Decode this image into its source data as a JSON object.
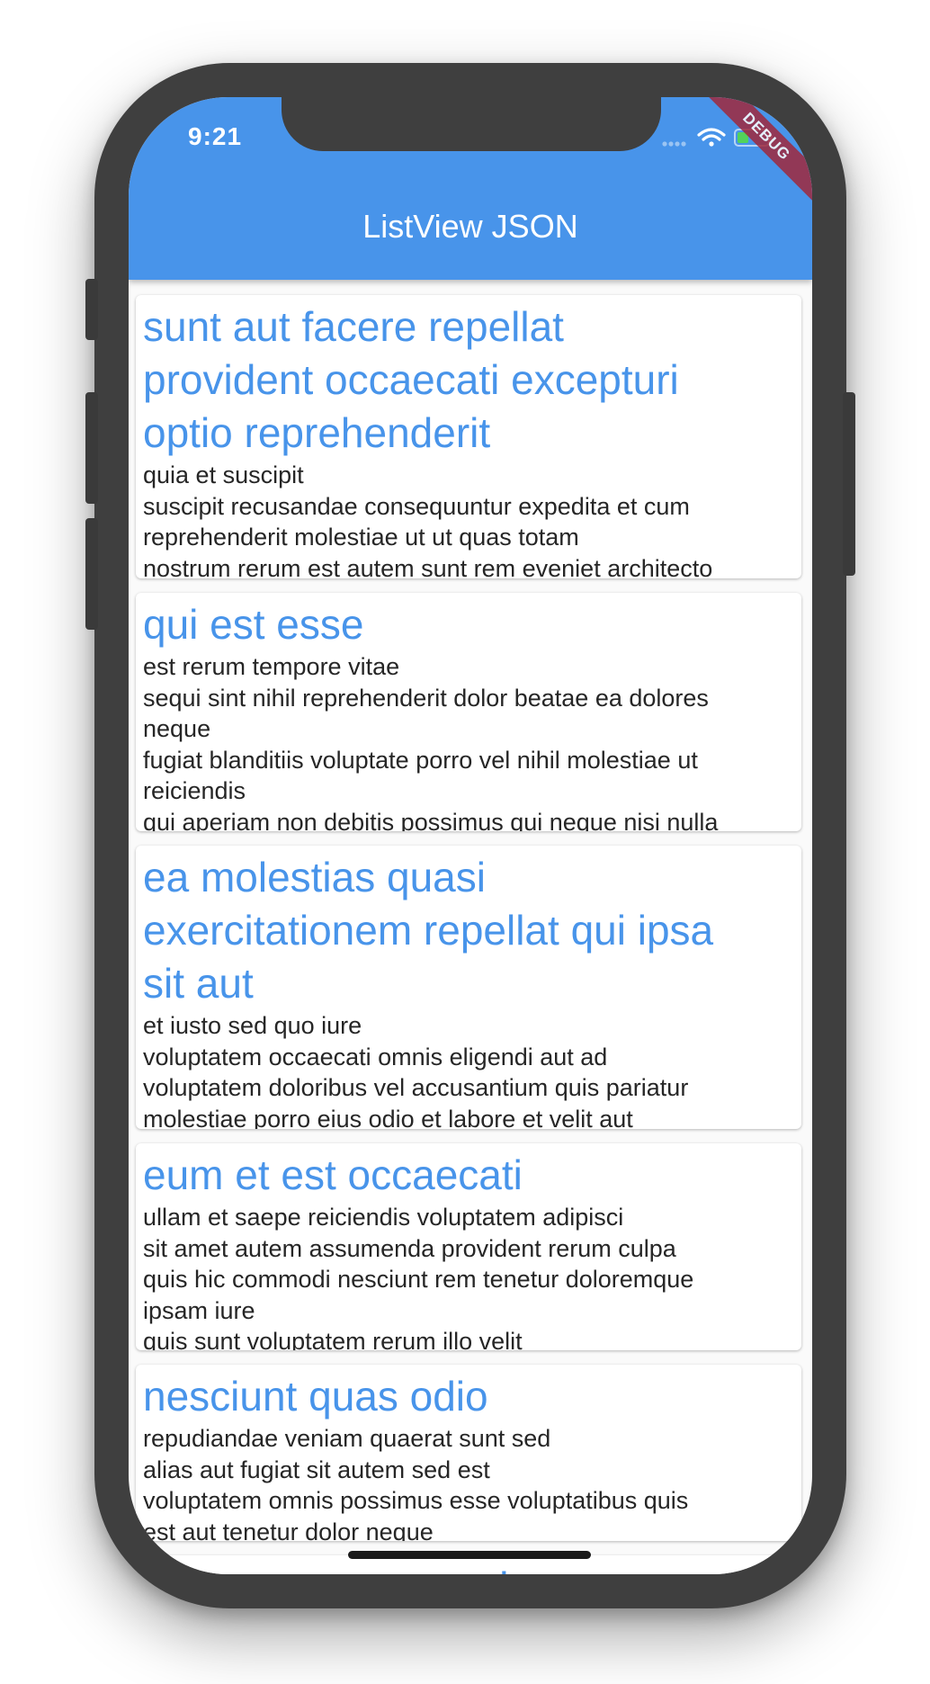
{
  "status_bar": {
    "time": "9:21",
    "icons": [
      "signal-icon",
      "wifi-icon",
      "battery-icon"
    ]
  },
  "debug_banner": "DEBUG",
  "app_bar": {
    "title": "ListView JSON",
    "color": "#4894ea"
  },
  "posts": [
    {
      "title": "sunt aut facere repellat\nprovident occaecati excepturi\noptio reprehenderit",
      "body": "quia et suscipit\nsuscipit recusandae consequuntur expedita et cum\nreprehenderit molestiae ut ut quas totam\nnostrum rerum est autem sunt rem eveniet architecto"
    },
    {
      "title": "qui est esse",
      "body": "est rerum tempore vitae\nsequi sint nihil reprehenderit dolor beatae ea dolores\nneque\nfugiat blanditiis voluptate porro vel nihil molestiae ut\nreiciendis\nqui aperiam non debitis possimus qui neque nisi nulla"
    },
    {
      "title": "ea molestias quasi\nexercitationem repellat qui ipsa\nsit aut",
      "body": "et iusto sed quo iure\nvoluptatem occaecati omnis eligendi aut ad\nvoluptatem doloribus vel accusantium quis pariatur\nmolestiae porro eius odio et labore et velit aut"
    },
    {
      "title": "eum et est occaecati",
      "body": "ullam et saepe reiciendis voluptatem adipisci\nsit amet autem assumenda provident rerum culpa\nquis hic commodi nesciunt rem tenetur doloremque\nipsam iure\nquis sunt voluptatem rerum illo velit"
    },
    {
      "title": "nesciunt quas odio",
      "body": "repudiandae veniam quaerat sunt sed\nalias aut fugiat sit autem sed est\nvoluptatem omnis possimus esse voluptatibus quis\nest aut tenetur dolor neque"
    },
    {
      "title": "dolorem eum magni eos",
      "body": ""
    }
  ]
}
